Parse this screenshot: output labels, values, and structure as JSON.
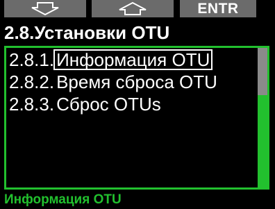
{
  "softkeys": {
    "down_icon": "arrow-down-icon",
    "up_icon": "arrow-up-icon",
    "enter_label": "ENTR"
  },
  "title": "2.8.Установки OTU",
  "menu": {
    "items": [
      {
        "number": "2.8.1.",
        "label": "Информация OTU"
      },
      {
        "number": "2.8.2.",
        "label": "Время сброса OTU"
      },
      {
        "number": "2.8.3.",
        "label": "Сброс OTUs"
      }
    ],
    "selected_index": 0
  },
  "status": "Информация OTU",
  "colors": {
    "accent": "#22c02e",
    "softkey_bg": "#6b6b6b",
    "background": "#000000"
  }
}
